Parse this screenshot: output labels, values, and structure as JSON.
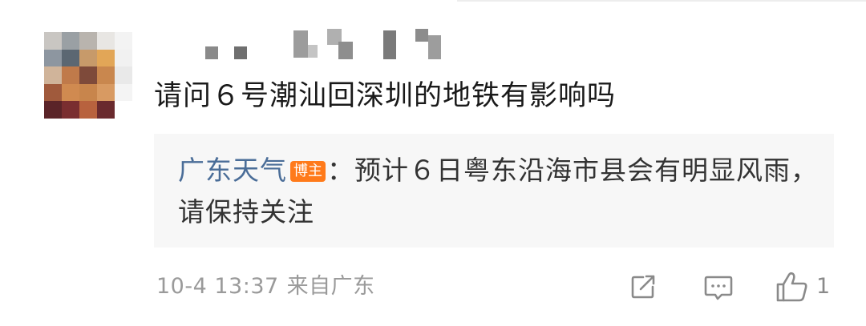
{
  "comment": {
    "text": "请问６号潮汕回深圳的地铁有影响吗"
  },
  "reply": {
    "author": "广东天气",
    "badge": "博主",
    "separator": "：",
    "text": "预计６日粤东沿海市县会有明显风雨，请保持关注"
  },
  "meta": {
    "date": "10-4 13:37",
    "location": "来自广东"
  },
  "actions": {
    "share_icon": "share-icon",
    "comment_icon": "comment-icon",
    "like_icon": "thumbs-up-icon",
    "like_count": "1"
  },
  "colors": {
    "author_link": "#4a6d98",
    "badge_bg": "#ff7a1a",
    "reply_bg": "#f7f7f7",
    "meta_text": "#9a9a9a"
  }
}
